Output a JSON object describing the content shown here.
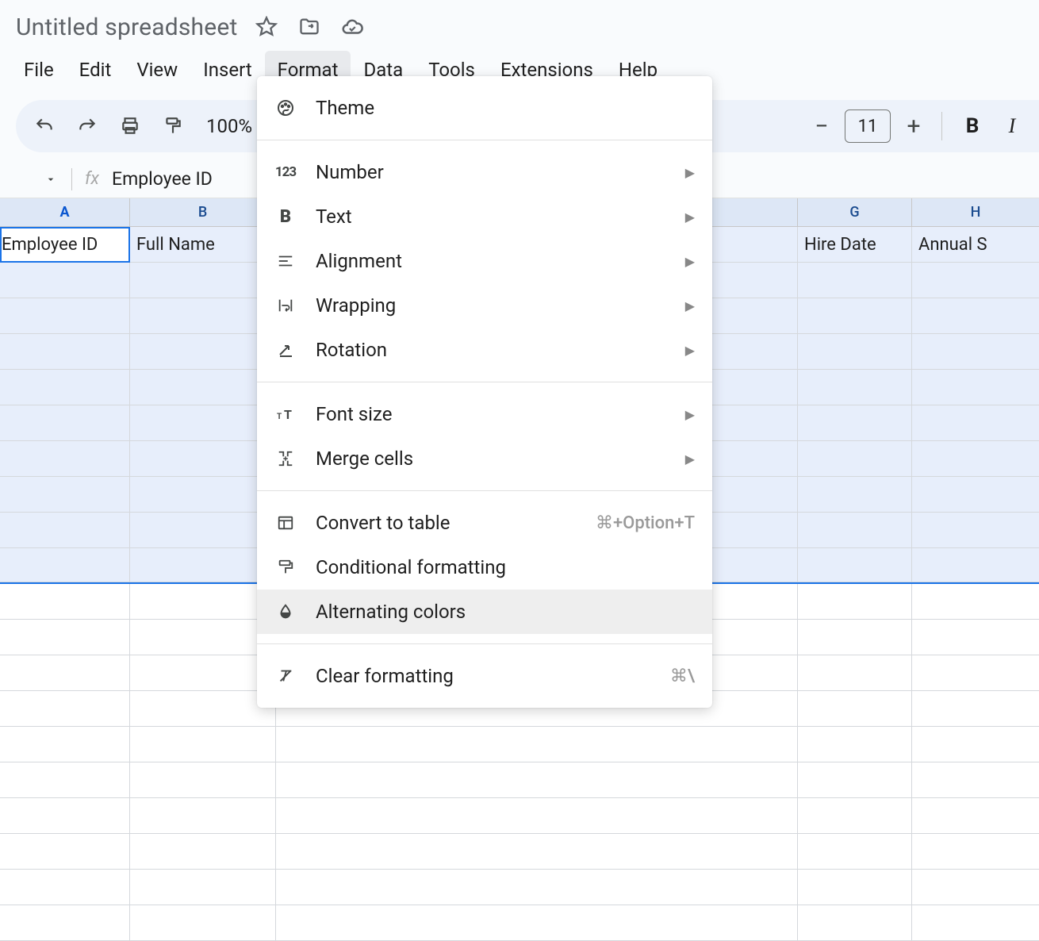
{
  "doc": {
    "title": "Untitled spreadsheet"
  },
  "menubar": [
    "File",
    "Edit",
    "View",
    "Insert",
    "Format",
    "Data",
    "Tools",
    "Extensions",
    "Help"
  ],
  "active_menu_index": 4,
  "toolbar": {
    "zoom": "100%",
    "font_size": "11"
  },
  "formula_bar": {
    "fx": "fx",
    "content": "Employee ID"
  },
  "columns": [
    "A",
    "B",
    "G",
    "H"
  ],
  "header_row": {
    "a": "Employee ID",
    "b": "Full Name",
    "g": "Hire Date",
    "h": "Annual S"
  },
  "format_menu": {
    "items": [
      {
        "key": "theme",
        "label": "Theme",
        "submenu": false
      },
      {
        "divider": true
      },
      {
        "key": "number",
        "label": "Number",
        "submenu": true
      },
      {
        "key": "text",
        "label": "Text",
        "submenu": true
      },
      {
        "key": "alignment",
        "label": "Alignment",
        "submenu": true
      },
      {
        "key": "wrapping",
        "label": "Wrapping",
        "submenu": true
      },
      {
        "key": "rotation",
        "label": "Rotation",
        "submenu": true
      },
      {
        "divider": true
      },
      {
        "key": "font_size",
        "label": "Font size",
        "submenu": true
      },
      {
        "key": "merge_cells",
        "label": "Merge cells",
        "submenu": true
      },
      {
        "divider": true
      },
      {
        "key": "convert_table",
        "label": "Convert to table",
        "shortcut": "⌘+Option+T"
      },
      {
        "key": "conditional",
        "label": "Conditional formatting"
      },
      {
        "key": "alternating",
        "label": "Alternating colors",
        "highlight": true
      },
      {
        "divider": true
      },
      {
        "key": "clear",
        "label": "Clear formatting",
        "shortcut": "⌘\\"
      }
    ]
  }
}
